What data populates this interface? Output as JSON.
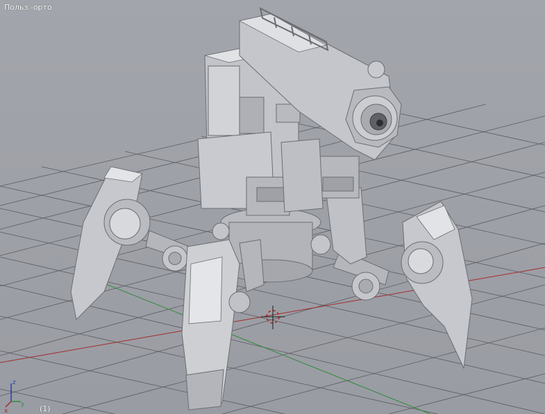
{
  "viewport": {
    "view_label": "Польз.-орто",
    "frame_label": "(1)",
    "colors": {
      "background": "#a0a2a9",
      "grid": "#55575c",
      "x_axis": "#9b2a2a",
      "y_axis": "#2f8c3a",
      "z_axis": "#2a3fa8",
      "model": "#c9cbd0"
    },
    "gizmo": {
      "x_label": "x",
      "y_label": "y",
      "z_label": "z"
    },
    "object": "spider-mech-model",
    "cursor": "3d-cursor-icon"
  }
}
